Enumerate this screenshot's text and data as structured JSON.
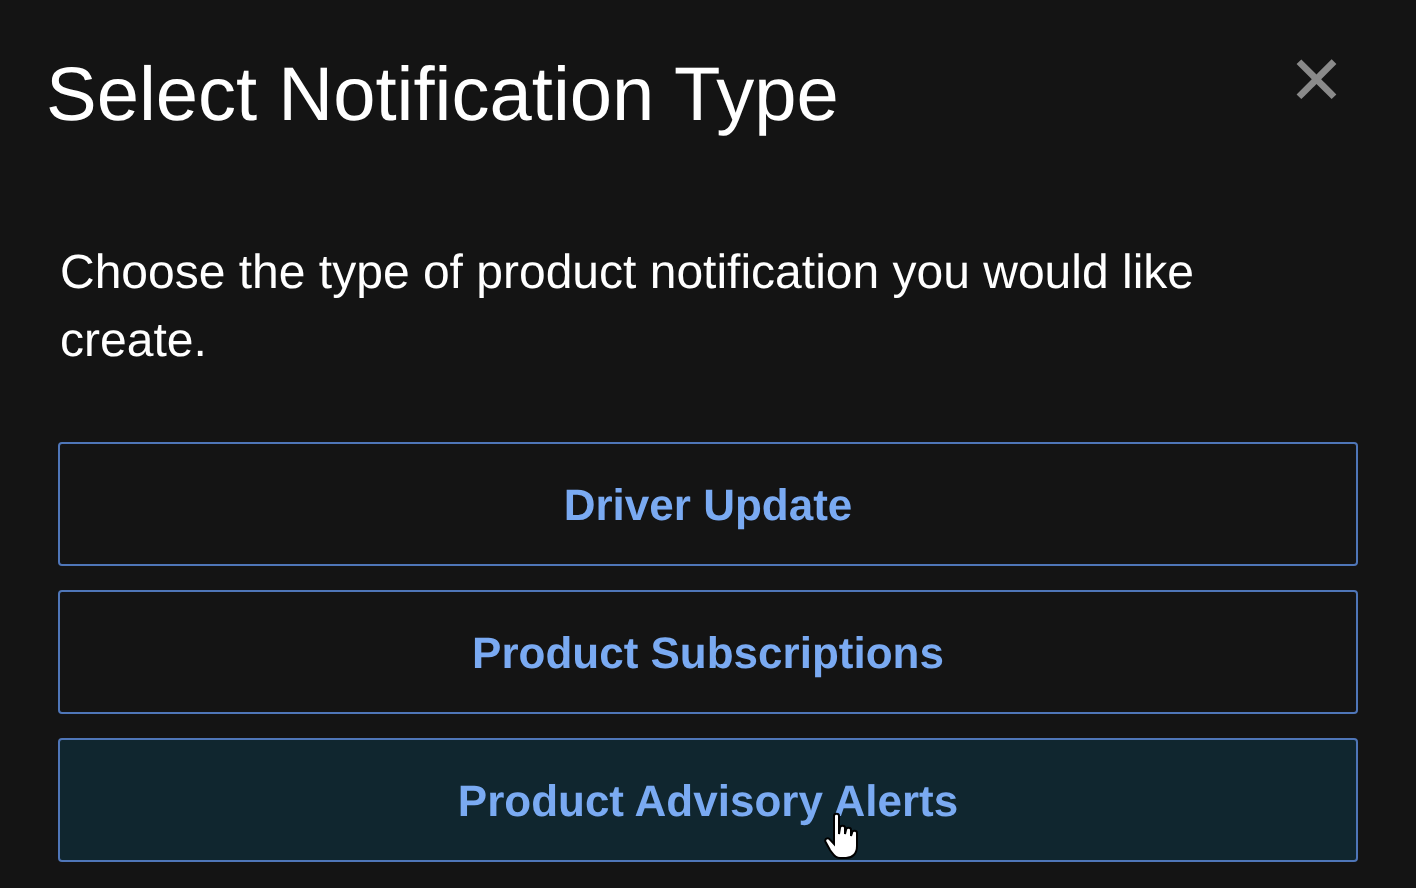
{
  "dialog": {
    "title": "Select Notification Type",
    "close_label": "✕",
    "description": "Choose the type of product notification you would like create."
  },
  "options": [
    {
      "label": "Driver Update",
      "hovered": false
    },
    {
      "label": "Product Subscriptions",
      "hovered": false
    },
    {
      "label": "Product Advisory Alerts",
      "hovered": true
    }
  ]
}
